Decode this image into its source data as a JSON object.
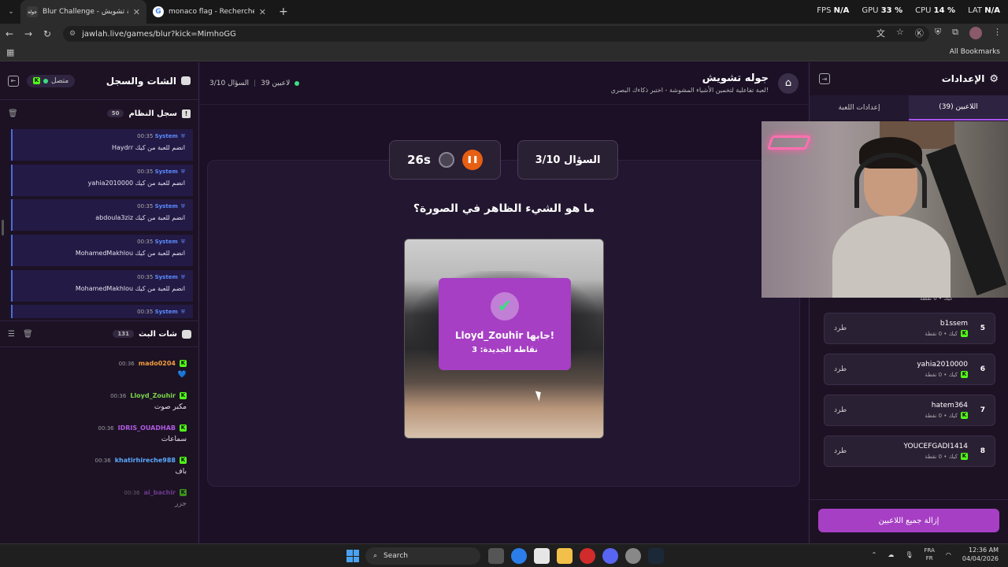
{
  "browser": {
    "tabs": [
      {
        "title": "Blur Challenge - جولة تشويش",
        "favicon": "جولة"
      },
      {
        "title": "monaco flag - Recherche Goog",
        "favicon": "G"
      }
    ],
    "stats": {
      "fps_label": "FPS",
      "fps": "N/A",
      "gpu_label": "GPU",
      "gpu": "33 %",
      "cpu_label": "CPU",
      "cpu": "14 %",
      "lat_label": "LAT",
      "lat": "N/A"
    },
    "url": "jawlah.live/games/blur?kick=MimhoGG",
    "all_bookmarks": "All Bookmarks"
  },
  "left_panel": {
    "title": "الشات والسجل",
    "online_label": "متصل",
    "system_log": {
      "title": "سجل النظام",
      "count": "50",
      "items": [
        {
          "sender": "System",
          "time": "00:35",
          "message": "Haydrr انضم للعبة من كيك"
        },
        {
          "sender": "System",
          "time": "00:35",
          "message": "yahia2010000 انضم للعبة من كيك"
        },
        {
          "sender": "System",
          "time": "00:35",
          "message": "abdoula3ziz انضم للعبة من كيك"
        },
        {
          "sender": "System",
          "time": "00:35",
          "message": "MohamedMakhlou انضم للعبة من كيك"
        },
        {
          "sender": "System",
          "time": "00:35",
          "message": "MohamedMakhlou انضم للعبة من كيك"
        },
        {
          "sender": "System",
          "time": "00:35",
          "message": ""
        }
      ]
    },
    "stream_chat": {
      "title": "شات البث",
      "count": "131",
      "messages": [
        {
          "user": "mado0204",
          "time": "00:36",
          "text": "💙",
          "color": "#f39c3d"
        },
        {
          "user": "Lloyd_Zouhir",
          "time": "00:36",
          "text": "مكبر صوت",
          "color": "#7bd64b"
        },
        {
          "user": "IDRIS_OUADHAB",
          "time": "00:36",
          "text": "سماعات",
          "color": "#b05be0"
        },
        {
          "user": "khatirhireche988",
          "time": "00:36",
          "text": "باف",
          "color": "#5aa9ff"
        },
        {
          "user": "ai_bachir",
          "time": "00:36",
          "text": "جزر",
          "color": "#b05be0"
        }
      ]
    }
  },
  "game": {
    "players_count": "39 لاعبين",
    "question_counter": "السؤال 3/10",
    "title": "جوله تشويش",
    "subtitle": "لعبة تفاعلية لتخمين الأشياء المشوشة - اختبر ذكاءك البصري!",
    "timer": "26s",
    "question_box": "السؤال 3/10",
    "question": "ما هو الشيء الظاهر في الصورة؟",
    "correct": {
      "title": "Lloyd_Zouhir جابها!",
      "subtitle": "نقاطه الجديدة: 3"
    }
  },
  "right_panel": {
    "title": "الإعدادات",
    "tabs": [
      "اللاعبين (39)",
      "إعدادات اللعبة"
    ],
    "partial_sub": "كيك • 0 نقطة",
    "players": [
      {
        "rank": "5",
        "name": "b1ssem",
        "sub": "كيك • 0 نقطة",
        "action": "طرد"
      },
      {
        "rank": "6",
        "name": "yahia2010000",
        "sub": "كيك • 0 نقطة",
        "action": "طرد"
      },
      {
        "rank": "7",
        "name": "hatem364",
        "sub": "كيك • 0 نقطة",
        "action": "طرد"
      },
      {
        "rank": "8",
        "name": "YOUCEFGADI1414",
        "sub": "كيك • 0 نقطة",
        "action": "طرد"
      }
    ],
    "remove_all": "إزالة جميع اللاعبين"
  },
  "taskbar": {
    "search": "Search",
    "lang_top": "FRA",
    "lang_bottom": "FR",
    "time": "12:36 AM",
    "date": "04/04/2026"
  }
}
